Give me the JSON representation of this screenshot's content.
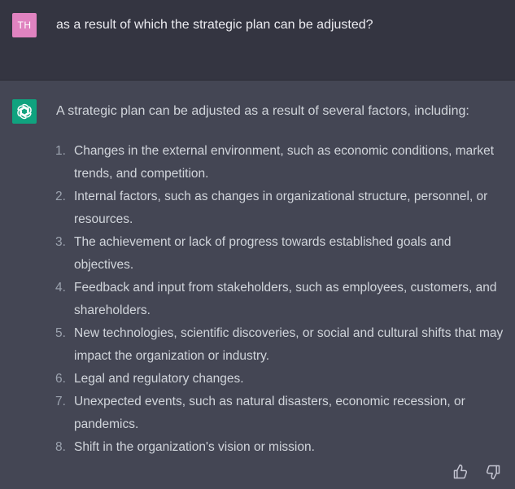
{
  "user_message": {
    "avatar_initials": "TH",
    "text": "as a result of which the strategic plan can be adjusted?"
  },
  "assistant_message": {
    "avatar_icon": "openai-logo-icon",
    "intro": "A strategic plan can be adjusted as a result of several factors, including:",
    "items": [
      {
        "num": "1.",
        "text": "Changes in the external environment, such as economic conditions, market trends, and competition."
      },
      {
        "num": "2.",
        "text": "Internal factors, such as changes in organizational structure, personnel, or resources."
      },
      {
        "num": "3.",
        "text": "The achievement or lack of progress towards established goals and objectives."
      },
      {
        "num": "4.",
        "text": "Feedback and input from stakeholders, such as employees, customers, and shareholders."
      },
      {
        "num": "5.",
        "text": "New technologies, scientific discoveries, or social and cultural shifts that may impact the organization or industry."
      },
      {
        "num": "6.",
        "text": "Legal and regulatory changes."
      },
      {
        "num": "7.",
        "text": "Unexpected events, such as natural disasters, economic recession, or pandemics."
      },
      {
        "num": "8.",
        "text": "Shift in the organization's vision or mission."
      }
    ]
  },
  "feedback": {
    "thumbs_up_icon": "thumbs-up-icon",
    "thumbs_down_icon": "thumbs-down-icon"
  },
  "colors": {
    "user_bg": "#343541",
    "assistant_bg": "#444654",
    "user_avatar": "#e083c0",
    "bot_avatar": "#10a37f",
    "text": "#d1d5db"
  }
}
